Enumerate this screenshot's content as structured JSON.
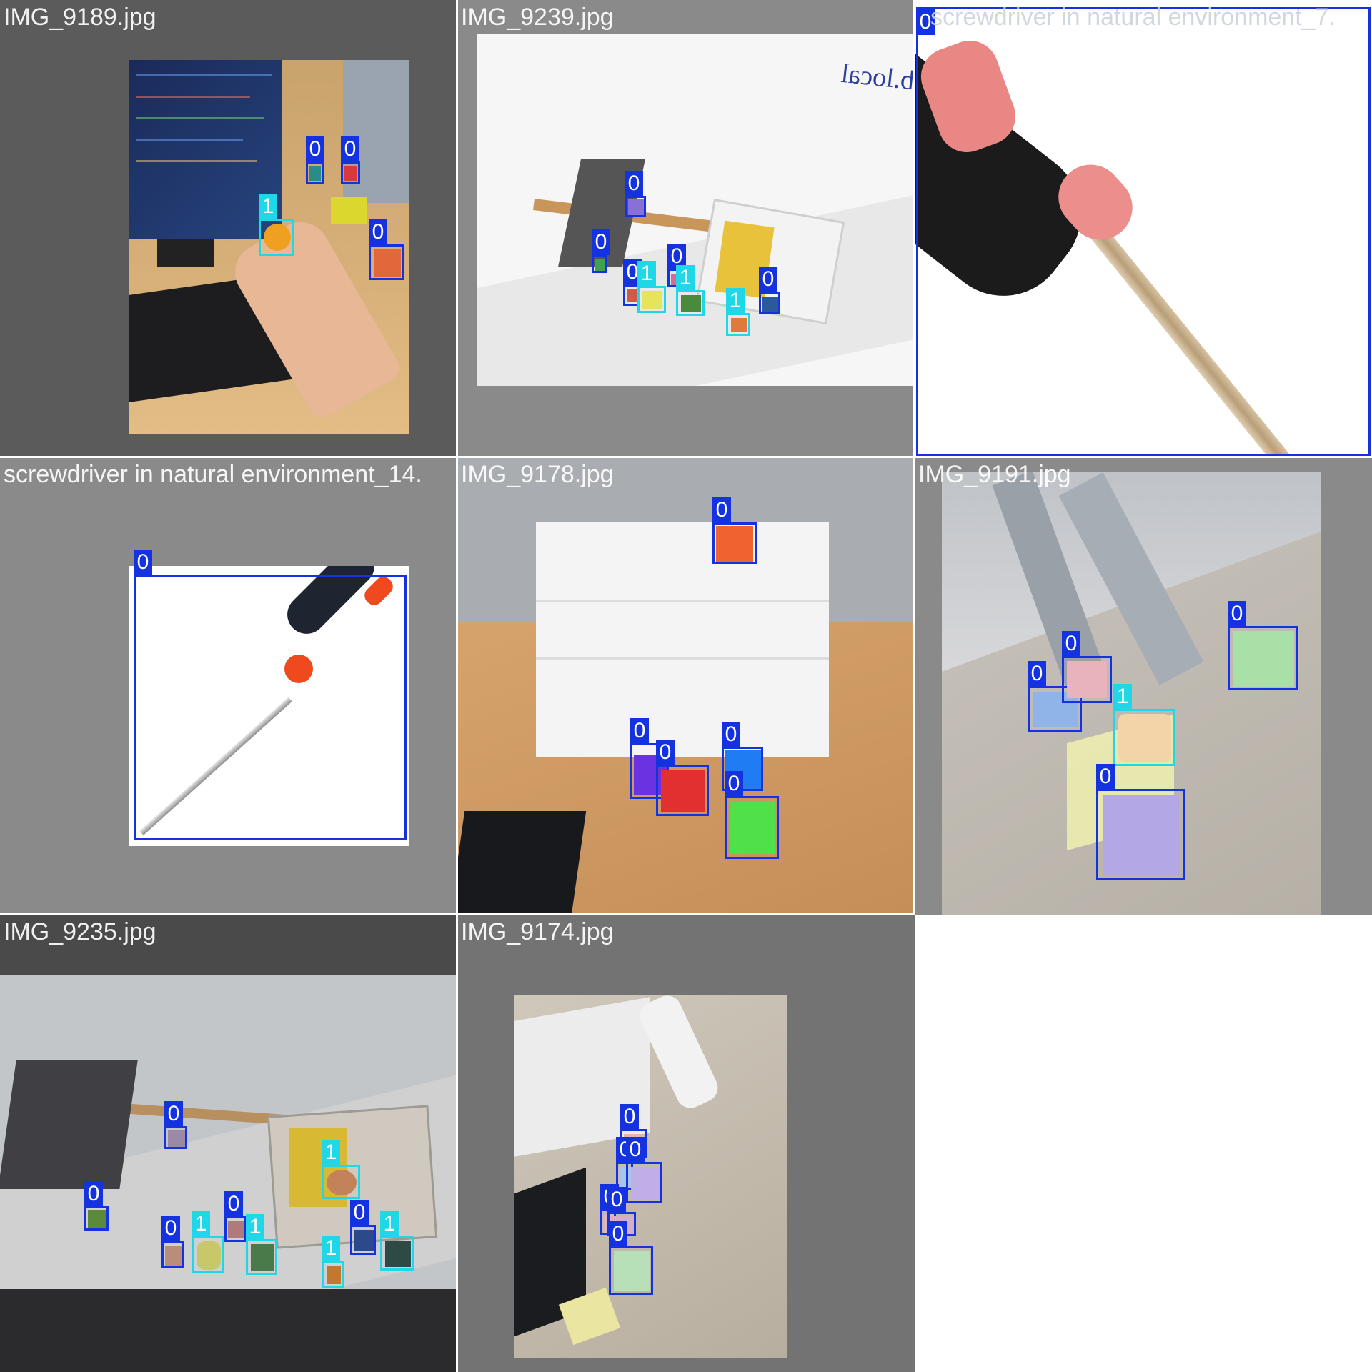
{
  "colors": {
    "class0_box": "#1532e0",
    "class1_box": "#1fd7e6",
    "tile_gray": "#8a8a8a",
    "tile_dark": "#5a5a5a"
  },
  "tiles": [
    {
      "filename": "IMG_9189.jpg",
      "boxes": [
        {
          "label": "0"
        },
        {
          "label": "0"
        },
        {
          "label": "1"
        },
        {
          "label": "0"
        }
      ]
    },
    {
      "filename": "IMG_9239.jpg",
      "whiteboard_text": "b.local",
      "boxes": [
        {
          "label": "0"
        },
        {
          "label": "0"
        },
        {
          "label": "0"
        },
        {
          "label": "0"
        },
        {
          "label": "1"
        },
        {
          "label": "1"
        },
        {
          "label": "0"
        },
        {
          "label": "1"
        }
      ]
    },
    {
      "filename": "screwdriver in natural environment_7.",
      "boxes": [
        {
          "label": "0"
        }
      ]
    },
    {
      "filename": "screwdriver in natural environment_14.",
      "boxes": [
        {
          "label": "0"
        }
      ]
    },
    {
      "filename": "IMG_9178.jpg",
      "boxes": [
        {
          "label": "0"
        },
        {
          "label": "0"
        },
        {
          "label": "0"
        },
        {
          "label": "0"
        },
        {
          "label": "0"
        }
      ]
    },
    {
      "filename": "IMG_9191.jpg",
      "boxes": [
        {
          "label": "0"
        },
        {
          "label": "0"
        },
        {
          "label": "0"
        },
        {
          "label": "1"
        },
        {
          "label": "0"
        }
      ]
    },
    {
      "filename": "IMG_9235.jpg",
      "boxes": [
        {
          "label": "0"
        },
        {
          "label": "0"
        },
        {
          "label": "1"
        },
        {
          "label": "0"
        },
        {
          "label": "1"
        },
        {
          "label": "1"
        },
        {
          "label": "0"
        },
        {
          "label": "0"
        },
        {
          "label": "1"
        },
        {
          "label": "1"
        }
      ]
    },
    {
      "filename": "IMG_9174.jpg",
      "boxes": [
        {
          "label": "0"
        },
        {
          "label": "0"
        },
        {
          "label": "0"
        },
        {
          "label": "0"
        },
        {
          "label": "0"
        },
        {
          "label": "0"
        }
      ]
    }
  ]
}
